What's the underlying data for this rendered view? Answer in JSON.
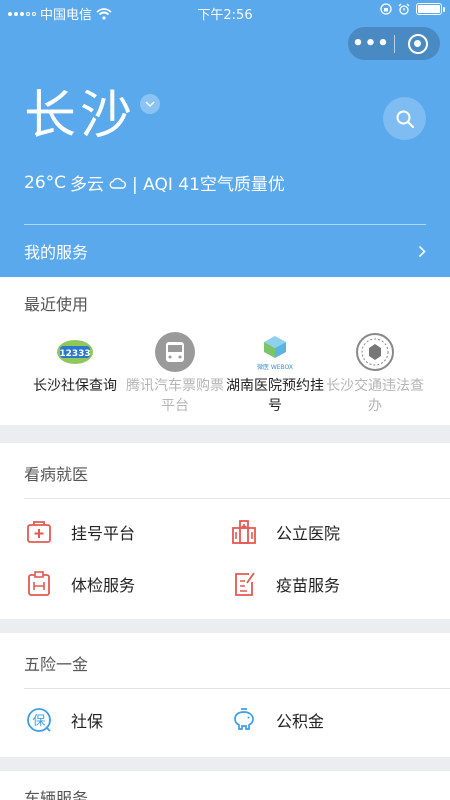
{
  "status_bar": {
    "carrier": "中国电信",
    "time": "下午2:56"
  },
  "header": {
    "city": "长沙",
    "weather": {
      "temp": "26°C",
      "condition": "多云",
      "aqi": "| AQI 41空气质量优"
    },
    "my_services_label": "我的服务"
  },
  "recent": {
    "title": "最近使用",
    "items": [
      {
        "label": "长沙社保查询",
        "badge_text": "12333",
        "dimmed": false
      },
      {
        "label": "腾讯汽车票购票平台",
        "dimmed": true
      },
      {
        "label": "湖南医院预约挂号",
        "badge_text": "微医 WEBOX",
        "dimmed": false
      },
      {
        "label": "长沙交通违法查办",
        "dimmed": true
      }
    ]
  },
  "medical": {
    "title": "看病就医",
    "items": [
      {
        "label": "挂号平台",
        "icon": "hospital-bag-icon"
      },
      {
        "label": "公立医院",
        "icon": "hospital-building-icon"
      },
      {
        "label": "体检服务",
        "icon": "clipboard-health-icon"
      },
      {
        "label": "疫苗服务",
        "icon": "vaccine-form-icon"
      }
    ]
  },
  "insurance": {
    "title": "五险一金",
    "items": [
      {
        "label": "社保",
        "icon": "social-security-icon",
        "icon_char": "保"
      },
      {
        "label": "公积金",
        "icon": "piggy-bank-icon"
      }
    ]
  },
  "vehicle": {
    "title": "车辆服务"
  },
  "colors": {
    "header_bg": "#5aa9ed",
    "medical_red": "#e45a52",
    "insurance_blue": "#3c9ee6",
    "page_bg": "#ecedf1"
  }
}
